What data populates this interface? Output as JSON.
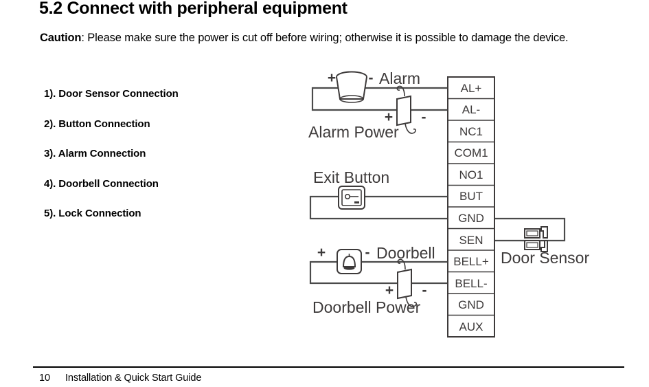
{
  "heading": "5.2 Connect with peripheral equipment",
  "caution": {
    "label": "Caution",
    "text": ": Please make sure the power is cut off before wiring; otherwise it is possible to damage the device."
  },
  "connection_list": [
    "1). Door Sensor Connection",
    "2). Button Connection",
    "3). Alarm Connection",
    "4). Doorbell Connection",
    "5). Lock Connection"
  ],
  "diagram": {
    "terminals": [
      "AL+",
      "AL-",
      "NC1",
      "COM1",
      "NO1",
      "BUT",
      "GND",
      "SEN",
      "BELL+",
      "BELL-",
      "GND",
      "AUX"
    ],
    "labels": {
      "alarm": "Alarm",
      "alarm_power": "Alarm Power",
      "exit_button": "Exit  Button",
      "doorbell": "Doorbell",
      "doorbell_power": "Doorbell  Power",
      "door_sensor": "Door  Sensor"
    },
    "polarity": {
      "plus": "+",
      "minus": "-"
    },
    "colors": {
      "wire": "#4a4a4a",
      "outline": "#3d3a3a",
      "text": "#3d3a3a"
    }
  },
  "footer": {
    "page_number": "10",
    "title": "Installation & Quick Start Guide"
  }
}
